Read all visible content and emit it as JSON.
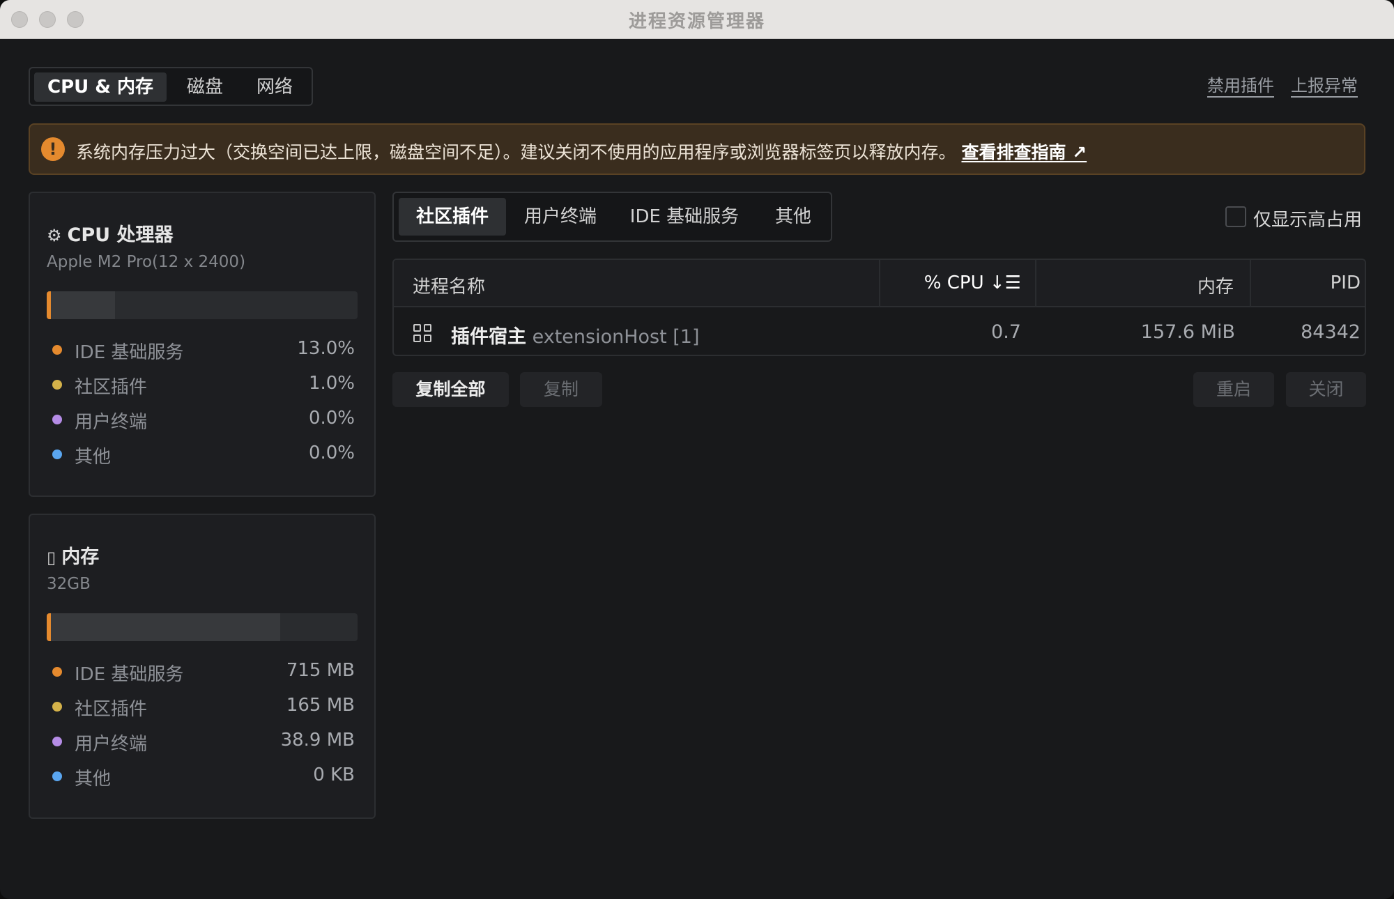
{
  "window": {
    "title": "进程资源管理器"
  },
  "top_tabs": [
    {
      "label": "CPU & 内存",
      "active": true
    },
    {
      "label": "磁盘",
      "active": false
    },
    {
      "label": "网络",
      "active": false
    }
  ],
  "top_links": {
    "disable_plugins": "禁用插件",
    "report_issue": "上报异常"
  },
  "alert": {
    "icon": "warning-icon",
    "message": "系统内存压力过大（交换空间已达上限，磁盘空间不足）。建议关闭不使用的应用程序或浏览器标签页以释放内存。",
    "link": "查看排查指南 ↗",
    "color": "#e58a2e"
  },
  "cpu": {
    "title": "CPU 处理器",
    "icon": "cpu-chip-icon",
    "subtitle": "Apple M2 Pro(12 x 2400)",
    "usage_fraction": 0.22,
    "legend": [
      {
        "label": "IDE 基础服务",
        "value": "13.0%",
        "color": "#e58a2e"
      },
      {
        "label": "社区插件",
        "value": "1.0%",
        "color": "#d4b24a"
      },
      {
        "label": "用户终端",
        "value": "0.0%",
        "color": "#b58ce6"
      },
      {
        "label": "其他",
        "value": "0.0%",
        "color": "#5aa6f0"
      }
    ]
  },
  "memory": {
    "title": "内存",
    "icon": "memory-card-icon",
    "subtitle": "32GB",
    "usage_fraction": 0.75,
    "legend": [
      {
        "label": "IDE 基础服务",
        "value": "715 MB",
        "color": "#e58a2e"
      },
      {
        "label": "社区插件",
        "value": "165 MB",
        "color": "#d4b24a"
      },
      {
        "label": "用户终端",
        "value": "38.9 MB",
        "color": "#b58ce6"
      },
      {
        "label": "其他",
        "value": "0 KB",
        "color": "#5aa6f0"
      }
    ]
  },
  "sub_tabs": [
    {
      "label": "社区插件",
      "active": true
    },
    {
      "label": "用户终端",
      "active": false
    },
    {
      "label": "IDE 基础服务",
      "active": false
    },
    {
      "label": "其他",
      "active": false
    }
  ],
  "filter": {
    "label": "仅显示高占用",
    "checked": false
  },
  "table": {
    "headers": {
      "name": "进程名称",
      "cpu": "% CPU ↓☰",
      "memory": "内存",
      "pid": "PID"
    },
    "rows": [
      {
        "icon": "grid-apps-icon",
        "name": "插件宿主",
        "detail": "extensionHost [1]",
        "cpu": "0.7",
        "memory": "157.6 MiB",
        "pid": "84342"
      }
    ]
  },
  "actions": {
    "copy_all": "复制全部",
    "copy": "复制",
    "restart": "重启",
    "close": "关闭"
  }
}
